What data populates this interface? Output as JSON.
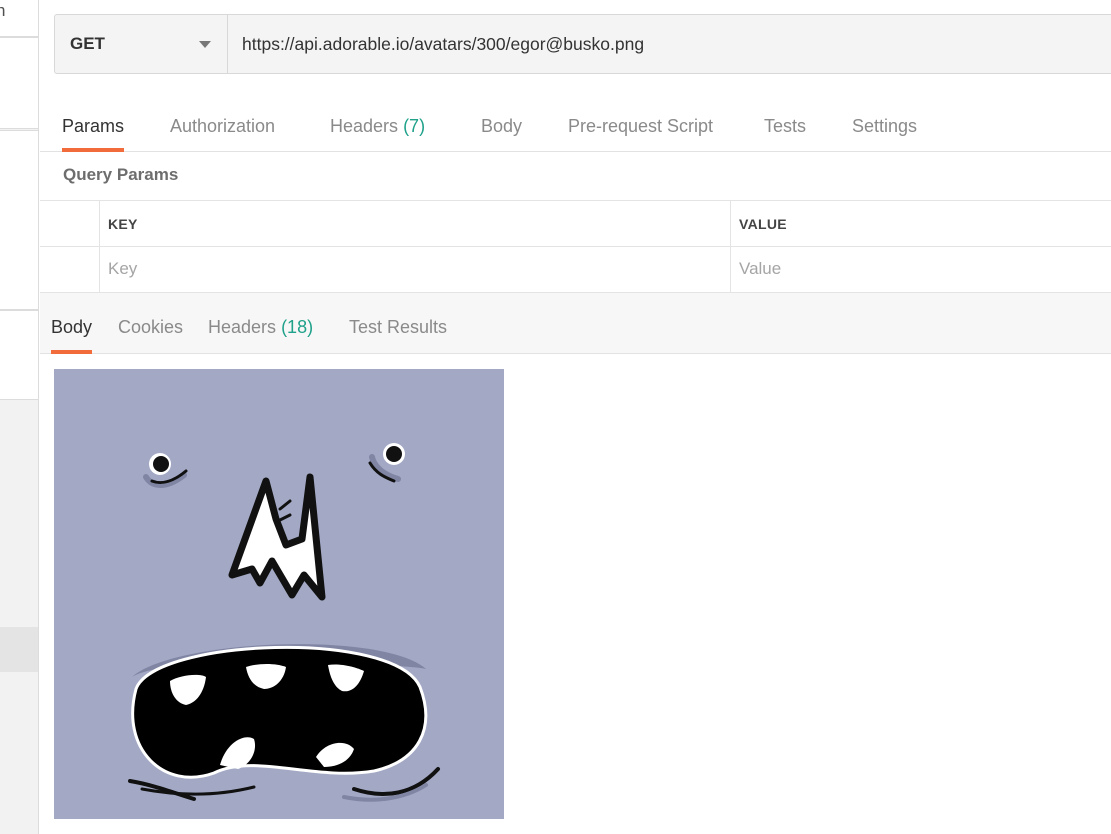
{
  "sidebar": {
    "clipped_text": "n"
  },
  "request": {
    "method": "GET",
    "url": "https://api.adorable.io/avatars/300/egor@busko.png"
  },
  "request_tabs": {
    "params": "Params",
    "authorization": "Authorization",
    "headers": "Headers",
    "headers_count": "(7)",
    "body": "Body",
    "pre_request_script": "Pre-request Script",
    "tests": "Tests",
    "settings": "Settings"
  },
  "query_params": {
    "title": "Query Params",
    "key_header": "KEY",
    "value_header": "VALUE",
    "key_placeholder": "Key",
    "value_placeholder": "Value"
  },
  "response_tabs": {
    "body": "Body",
    "cookies": "Cookies",
    "headers": "Headers",
    "headers_count": "(18)",
    "test_results": "Test Results"
  },
  "colors": {
    "accent": "#f26b3a",
    "count": "#1fa18a",
    "avatar_background": "#a3a9c5"
  }
}
